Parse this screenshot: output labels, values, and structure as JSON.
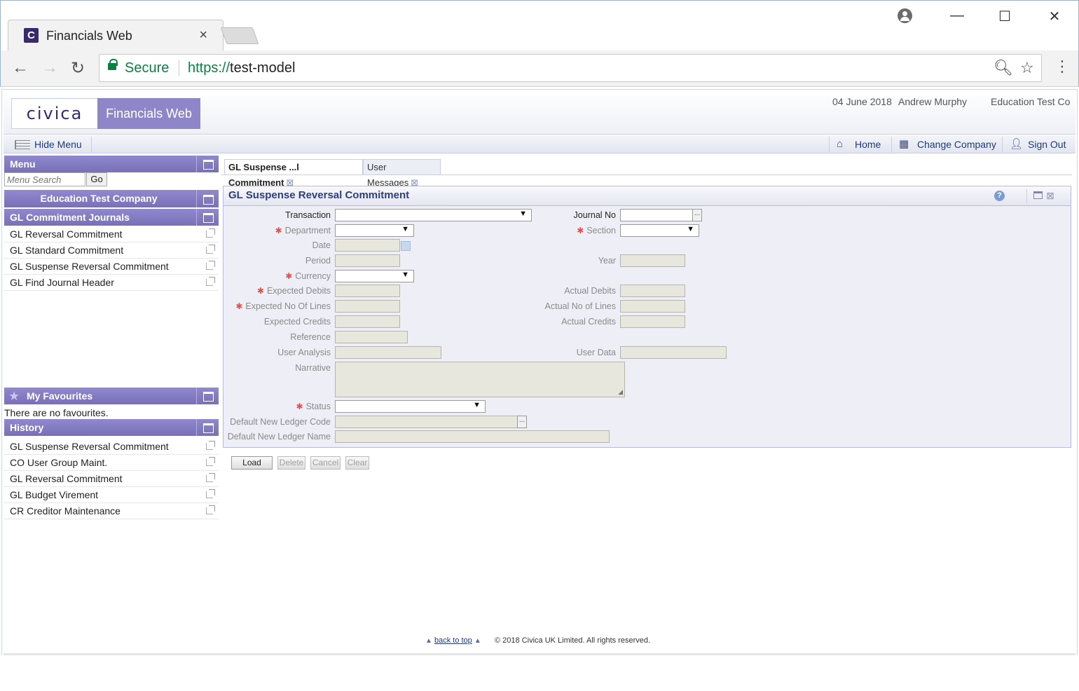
{
  "browser": {
    "tab_title": "Financials Web",
    "tab_close": "×",
    "favicon_letter": "C",
    "secure_label": "Secure",
    "url_scheme": "https://",
    "url_host": "test-model",
    "window_controls": {
      "minimize": "—",
      "maximize": "☐",
      "close": "✕"
    }
  },
  "header": {
    "logo_text": "civica",
    "product_name": "Financials Web",
    "date": "04 June 2018",
    "user": "Andrew Murphy",
    "company": "Education Test Co"
  },
  "menubar": {
    "hide_menu": "Hide Menu",
    "home": "Home",
    "change_company": "Change Company",
    "sign_out": "Sign Out"
  },
  "sidebar": {
    "menu_title": "Menu",
    "search_placeholder": "Menu Search",
    "go_label": "Go",
    "company_title": "Education Test Company",
    "section_title": "GL Commitment Journals",
    "items": [
      "GL Reversal Commitment",
      "GL Standard Commitment",
      "GL Suspense Reversal Commitment",
      "GL Find Journal Header"
    ],
    "favourites_title": "My Favourites",
    "no_favourites": "There are no favourites.",
    "history_title": "History",
    "history": [
      "GL Suspense Reversal Commitment",
      "CO User Group Maint.",
      "GL Reversal Commitment",
      "GL Budget Virement",
      "CR Creditor Maintenance"
    ]
  },
  "tabs": [
    {
      "label": "GL Suspense ...l Commitment",
      "active": true
    },
    {
      "label": "User Messages",
      "active": false
    }
  ],
  "tab_close_glyph": "⊠",
  "form": {
    "title": "GL Suspense Reversal Commitment",
    "help": "?",
    "required_marker": "✱",
    "labels": {
      "transaction": "Transaction",
      "journal_no": "Journal No",
      "department": "Department",
      "section": "Section",
      "date": "Date",
      "period": "Period",
      "year": "Year",
      "currency": "Currency",
      "expected_debits": "Expected Debits",
      "actual_debits": "Actual Debits",
      "expected_no_of_lines": "Expected No Of Lines",
      "actual_no_of_lines": "Actual No of Lines",
      "expected_credits": "Expected Credits",
      "actual_credits": "Actual Credits",
      "reference": "Reference",
      "user_analysis": "User Analysis",
      "user_data": "User Data",
      "narrative": "Narrative",
      "status": "Status",
      "default_new_ledger_code": "Default New Ledger Code",
      "default_new_ledger_name": "Default New Ledger Name"
    },
    "buttons": {
      "load": "Load",
      "delete": "Delete",
      "cancel": "Cancel",
      "clear": "Clear"
    }
  },
  "footer": {
    "back_to_top": "back to top",
    "copyright": "© 2018 Civica UK Limited. All rights reserved."
  },
  "colors": {
    "accent_purple": "#8e86c9",
    "header_purple": "#7970b8",
    "link_blue": "#1f3a7a",
    "required_red": "#e05050",
    "secure_green": "#0b8043"
  }
}
